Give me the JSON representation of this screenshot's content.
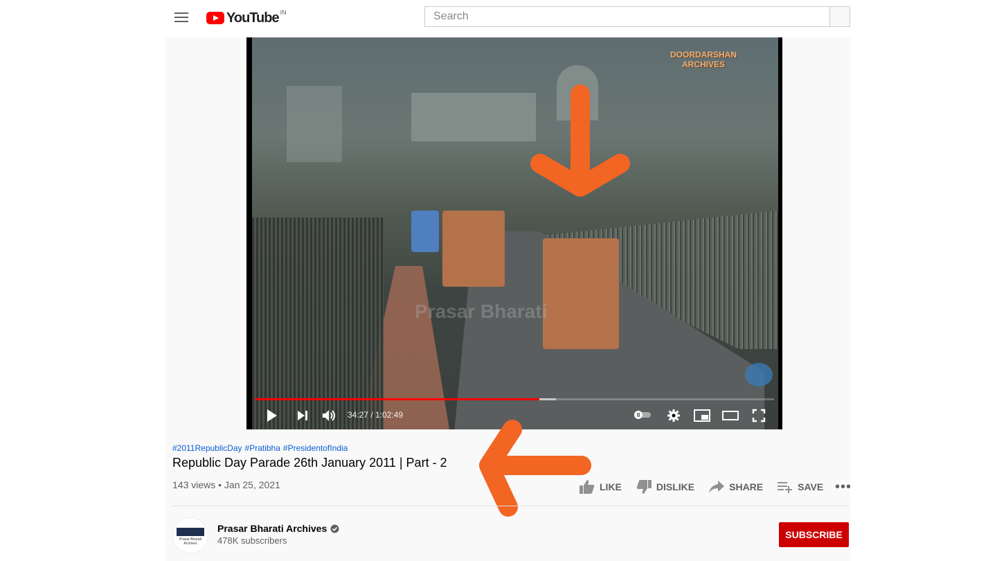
{
  "header": {
    "logo_text": "YouTube",
    "country_code": "IN",
    "search_placeholder": "Search"
  },
  "player": {
    "brand_overlay": "DOORDARSHAN\nARCHIVES",
    "watermark": "Prasar Bharati",
    "current_time": "34:27",
    "duration": "1:02:49",
    "time_display": "34:27 / 1:02:49",
    "progress_fraction": 0.5485,
    "buffered_fraction": 0.58
  },
  "video": {
    "hashtags": [
      "#2011RepublicDay",
      "#Pratibha",
      "#PresidentofIndia"
    ],
    "title": "Republic Day Parade 26th January 2011 | Part - 2",
    "views": "143 views",
    "date": "Jan 25, 2021",
    "meta_line": "143 views • Jan 25, 2021"
  },
  "actions": {
    "like": "LIKE",
    "dislike": "DISLIKE",
    "share": "SHARE",
    "save": "SAVE"
  },
  "channel": {
    "name": "Prasar Bharati Archives",
    "subscribers": "478K subscribers",
    "subscribe_label": "SUBSCRIBE"
  },
  "colors": {
    "youtube_red": "#ff0000",
    "subscribe_red": "#cc0000",
    "hashtag_blue": "#065fd4",
    "annotation_orange": "#f26522"
  },
  "icons": [
    "hamburger-icon",
    "youtube-logo-icon",
    "play-icon",
    "next-icon",
    "volume-icon",
    "autoplay-toggle-icon",
    "settings-gear-icon",
    "miniplayer-icon",
    "theater-mode-icon",
    "fullscreen-icon",
    "thumbs-up-icon",
    "thumbs-down-icon",
    "share-arrow-icon",
    "save-playlist-icon",
    "more-dots-icon",
    "verified-check-icon"
  ]
}
